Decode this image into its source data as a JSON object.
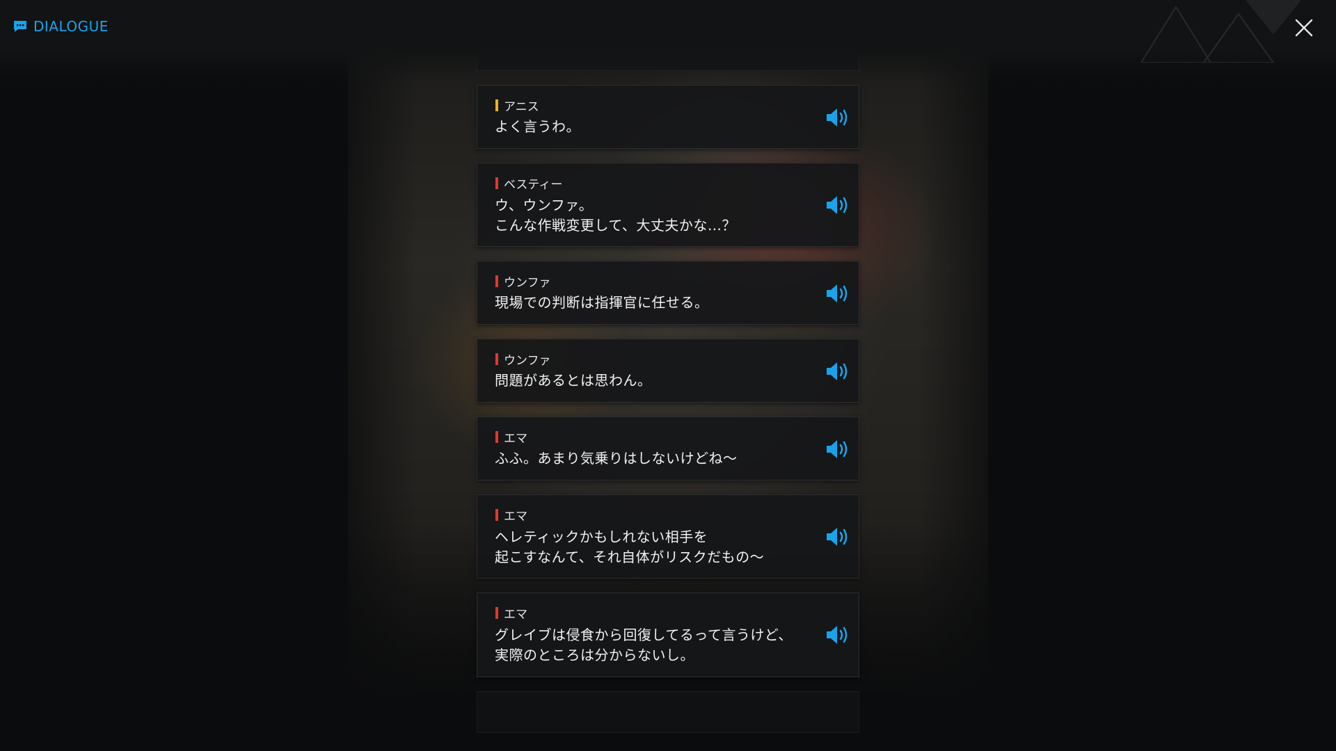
{
  "header": {
    "title": "DIALOGUE",
    "accent_color": "#1aa3ea",
    "title_icon": "chat-bubble-icon",
    "close_icon": "close-icon"
  },
  "dialogue": {
    "voice_icon": "speaker-volume-icon",
    "entries": [
      {
        "speaker": "アニス",
        "speaker_color": "#f0b21f",
        "lines": [
          "よく言うわ。"
        ]
      },
      {
        "speaker": "ベスティー",
        "speaker_color": "#e0392c",
        "lines": [
          "ウ、ウンファ。",
          "こんな作戦変更して、大丈夫かな…？"
        ]
      },
      {
        "speaker": "ウンファ",
        "speaker_color": "#e0392c",
        "lines": [
          "現場での判断は指揮官に任せる。"
        ]
      },
      {
        "speaker": "ウンファ",
        "speaker_color": "#e0392c",
        "lines": [
          "問題があるとは思わん。"
        ]
      },
      {
        "speaker": "エマ",
        "speaker_color": "#e0392c",
        "lines": [
          "ふふ。あまり気乗りはしないけどね～"
        ]
      },
      {
        "speaker": "エマ",
        "speaker_color": "#e0392c",
        "lines": [
          "ヘレティックかもしれない相手を",
          "起こすなんて、それ自体がリスクだもの～"
        ]
      },
      {
        "speaker": "エマ",
        "speaker_color": "#e0392c",
        "lines": [
          "グレイブは侵食から回復してるって言うけど、",
          "実際のところは分からないし。"
        ]
      }
    ]
  }
}
